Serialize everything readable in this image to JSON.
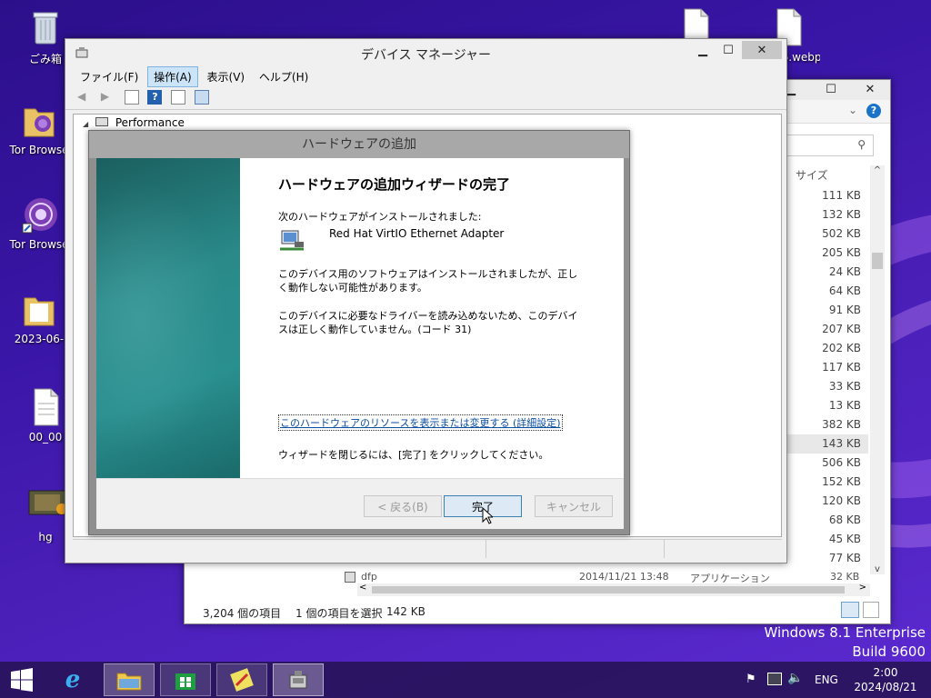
{
  "desktop": {
    "icons": [
      {
        "label": "ごみ箱"
      },
      {
        "label": "Tor Browse"
      },
      {
        "label": "Tor Browse"
      },
      {
        "label": "2023-06-"
      },
      {
        "label": "00_00"
      },
      {
        "label": "hg"
      },
      {
        "label": "36.webp"
      }
    ],
    "watermark": {
      "line1": "Windows 8.1 Enterprise",
      "line2": "Build 9600"
    }
  },
  "explorer": {
    "column_header": "サイズ",
    "sizes": [
      "111 KB",
      "132 KB",
      "502 KB",
      "205 KB",
      "24 KB",
      "64 KB",
      "91 KB",
      "207 KB",
      "202 KB",
      "117 KB",
      "33 KB",
      "13 KB",
      "382 KB",
      "143 KB",
      "506 KB",
      "152 KB",
      "120 KB",
      "68 KB",
      "45 KB",
      "77 KB",
      "32 KB"
    ],
    "bottom_row": {
      "name": "dfp",
      "date": "2014/11/21 13:48",
      "type": "アプリケーション"
    },
    "status": {
      "count": "3,204 個の項目",
      "selected": "1 個の項目を選択",
      "size": "142 KB"
    }
  },
  "device_manager": {
    "title": "デバイス マネージャー",
    "menu": [
      "ファイル(F)",
      "操作(A)",
      "表示(V)",
      "ヘルプ(H)"
    ],
    "tree_root": "Performance"
  },
  "wizard": {
    "title": "ハードウェアの追加",
    "heading": "ハードウェアの追加ウィザードの完了",
    "installed_label": "次のハードウェアがインストールされました:",
    "device_name": "Red Hat VirtIO Ethernet Adapter",
    "msg1": "このデバイス用のソフトウェアはインストールされましたが、正しく動作しない可能性があります。",
    "msg2": "このデバイスに必要なドライバーを読み込めないため、このデバイスは正しく動作していません。(コード 31)",
    "link": "このハードウェアのリソースを表示または変更する (詳細設定)",
    "close_hint": "ウィザードを閉じるには、[完了] をクリックしてください。",
    "buttons": {
      "back": "< 戻る(B)",
      "finish": "完了",
      "cancel": "キャンセル"
    }
  },
  "taskbar": {
    "lang": "ENG",
    "time": "2:00",
    "date": "2024/08/21"
  },
  "colors": {
    "desktop": "#3a16a8",
    "accent": "#3c7fb1",
    "wizard_side": "#1f7a7a"
  }
}
